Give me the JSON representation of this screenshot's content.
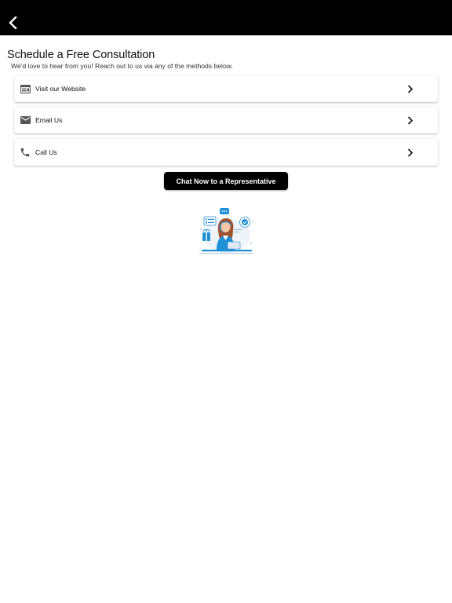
{
  "header": {
    "back_icon": "chevron-left-icon"
  },
  "page": {
    "title": "Schedule a Free Consultation",
    "subtitle": "We'd love to hear from you! Reach out to us via any of the methods below."
  },
  "options": [
    {
      "label": "Visit our Website",
      "icon": "web-icon"
    },
    {
      "label": "Email Us",
      "icon": "mail-icon"
    },
    {
      "label": "Call Us",
      "icon": "phone-icon"
    }
  ],
  "chat_button": {
    "label": "Chat Now to a Representative"
  },
  "colors": {
    "topbar": "#000000",
    "accent": "#1f8fd6",
    "button": "#000000"
  }
}
